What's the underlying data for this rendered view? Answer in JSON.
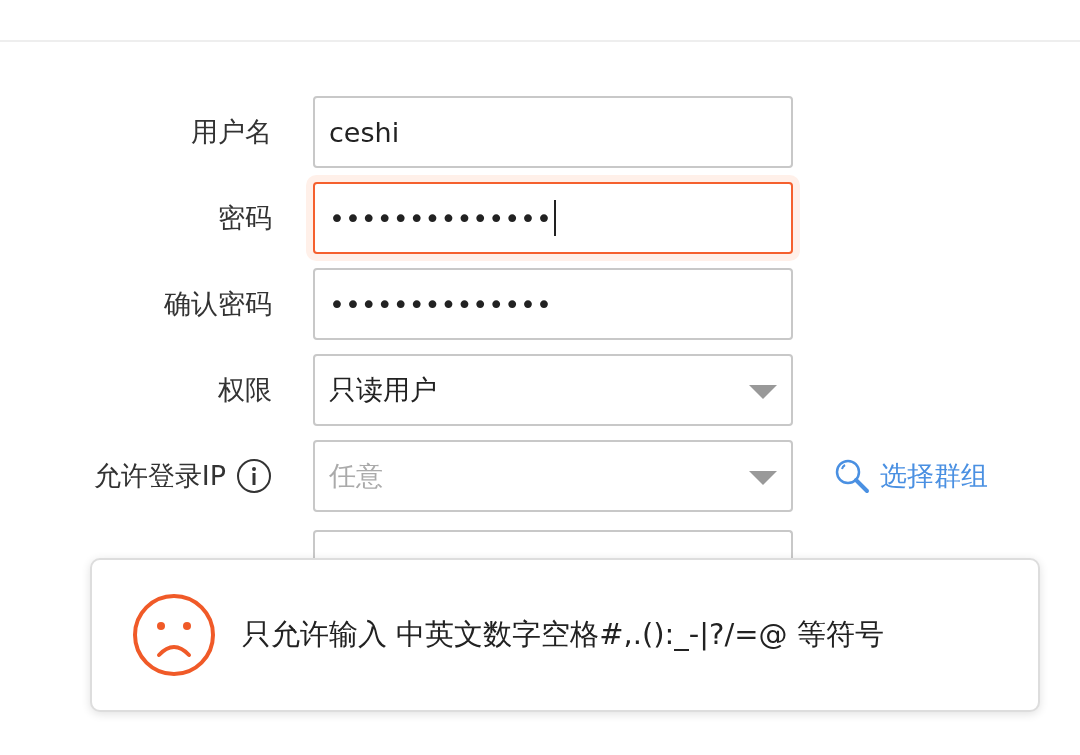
{
  "form": {
    "fields": [
      {
        "label": "用户名",
        "kind": "text",
        "value": "ceshi",
        "focused": false
      },
      {
        "label": "密码",
        "kind": "password",
        "value": "••••••••••••••",
        "focused": true
      },
      {
        "label": "确认密码",
        "kind": "password",
        "value": "••••••••••••••",
        "focused": false
      },
      {
        "label": "权限",
        "kind": "select",
        "value": "只读用户",
        "focused": false
      },
      {
        "label": "允许登录IP",
        "kind": "select",
        "placeholder": "任意",
        "info": true,
        "link": "选择群组",
        "focused": false
      }
    ]
  },
  "toast": {
    "kind": "error",
    "message": "只允许输入 中英文数字空格#,.():_-|?/=@ 等符号"
  }
}
